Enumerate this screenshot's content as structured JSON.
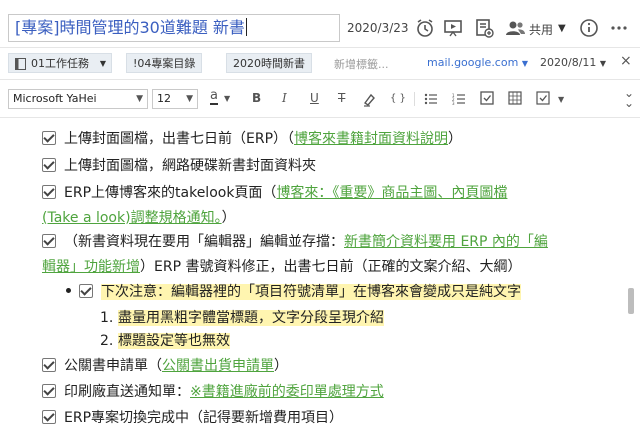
{
  "header": {
    "title": "[專案]時間管理的30道難題 新書",
    "date": "2020/3/23",
    "share_label": "共用",
    "icons": [
      "alarm-icon",
      "present-icon",
      "note-add-icon",
      "share-users-icon",
      "info-icon",
      "more-icon"
    ]
  },
  "tags": {
    "notebook": "01工作任務",
    "tag1": "!04專案目錄",
    "tag2": "2020時間新書",
    "new_tag_placeholder": "新增標籤...",
    "source": "mail.google.com",
    "reminder_date": "2020/8/11"
  },
  "format": {
    "font": "Microsoft YaHei",
    "size": "12",
    "text_color_label": "a",
    "bold": "B",
    "italic": "I",
    "underline": "U",
    "strike": "T",
    "code": "{ }"
  },
  "content": {
    "l1_text": "上傳封面圖檔，出書七日前（ERP）（",
    "l1_link": "博客來書籍封面資料說明",
    "l1_end": "）",
    "l2_text": "上傳封面圖檔，網路硬碟新書封面資料夾",
    "l3_text": "ERP上傳博客來的takelook頁面（",
    "l3_link_a": "博客來：《重要》商品主圖、內頁圖檔",
    "l3_link_b": "(Take a look)調整規格通知。",
    "l3_end": "）",
    "l4_text": "（新書資料現在要用「編輯器」編輯並存擋：",
    "l4_link_a": "新書簡介資料要用 ERP 內的「編",
    "l4_link_b": "輯器」功能新增",
    "l4_rest": "）ERP 書號資料修正，出書七日前（正確的文案介紹、大綱）",
    "l5_text": "下次注意：編輯器裡的「項目符號清單」在博客來會變成只是純文字",
    "l6_num": "1.",
    "l6_text": "盡量用黑粗字體當標題，文字分段呈現介紹",
    "l7_num": "2.",
    "l7_text": "標題設定等也無效",
    "l8_text": "公關書申請單（",
    "l8_link": "公關書出貨申請單",
    "l8_end": "）",
    "l9_text": "印刷廠直送通知單：",
    "l9_link": "※書籍進廠前的委印單處理方式",
    "l10_text": "ERP專案切換完成中（記得要新增費用項目）"
  },
  "colors": {
    "link": "#4fa43e",
    "highlight": "#fff5b0",
    "title_text": "#3b5fc0"
  }
}
